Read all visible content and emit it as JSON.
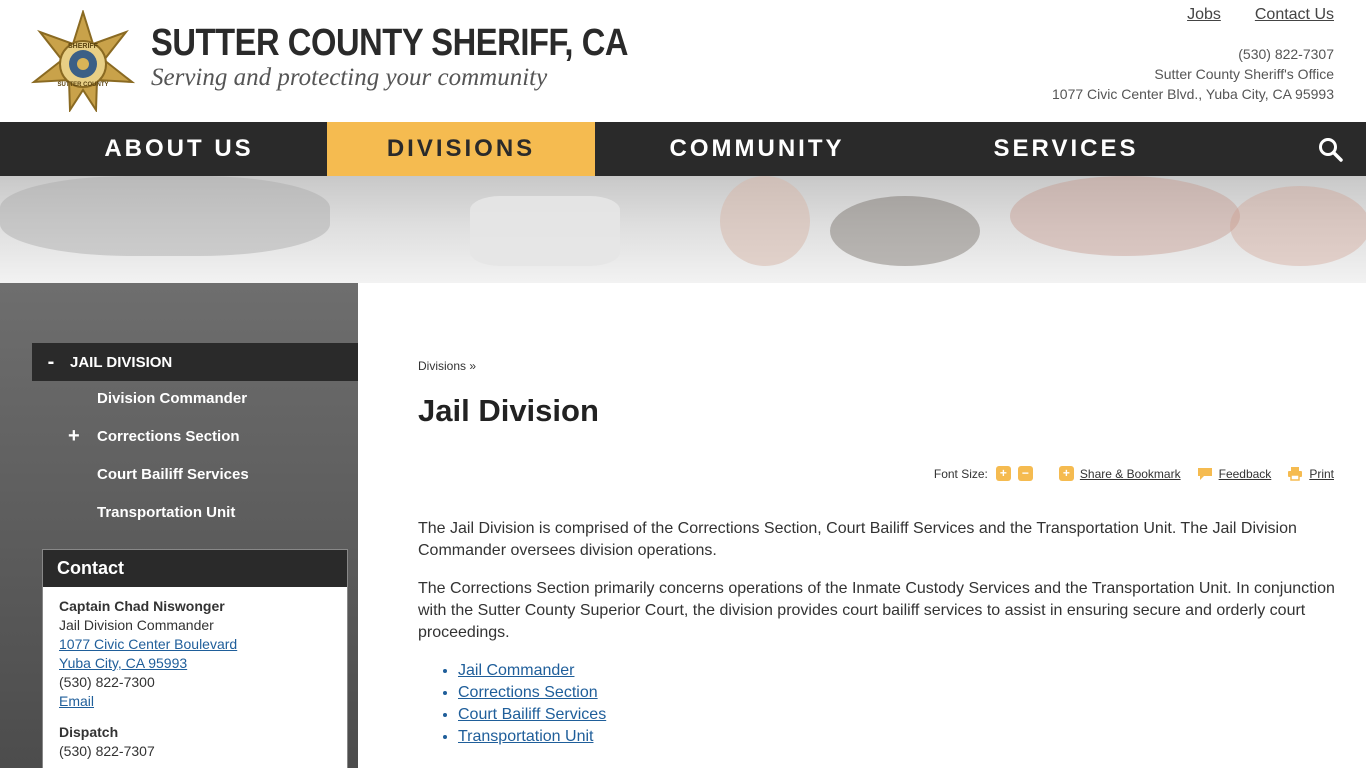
{
  "header": {
    "title": "SUTTER COUNTY SHERIFF, CA",
    "tagline": "Serving and protecting your community",
    "links": [
      {
        "label": "Jobs"
      },
      {
        "label": "Contact Us"
      }
    ],
    "phone": "(530) 822-7307",
    "office": "Sutter County Sheriff's Office",
    "address": "1077 Civic Center Blvd., Yuba City, CA 95993",
    "badge": {
      "top_text": "SHERIFF",
      "bottom_text": "SUTTER COUNTY"
    }
  },
  "nav": {
    "items": [
      {
        "label": "ABOUT US"
      },
      {
        "label": "DIVISIONS",
        "active": true
      },
      {
        "label": "COMMUNITY"
      },
      {
        "label": "SERVICES"
      }
    ],
    "search_icon": "search-icon"
  },
  "sidebar": {
    "active": {
      "toggle": "-",
      "label": "JAIL DIVISION"
    },
    "items": [
      {
        "label": "Division Commander"
      },
      {
        "label": "Corrections Section",
        "toggle": "+"
      },
      {
        "label": "Court Bailiff Services"
      },
      {
        "label": "Transportation Unit"
      }
    ]
  },
  "contact": {
    "heading": "Contact",
    "name": "Captain Chad Niswonger",
    "role": "Jail Division Commander",
    "address_line1": "1077 Civic Center Boulevard",
    "address_line2": "Yuba City, CA 95993",
    "phone": "(530) 822-7300",
    "email_label": "Email",
    "dispatch_heading": "Dispatch",
    "dispatch_phone": "(530) 822-7307"
  },
  "main": {
    "breadcrumb": "Divisions »",
    "title": "Jail Division",
    "tools": {
      "font_size_label": "Font Size:",
      "increase": "+",
      "decrease": "−",
      "share_icon": "+",
      "share_label": "Share & Bookmark",
      "feedback_label": "Feedback",
      "print_label": "Print"
    },
    "paragraphs": [
      "The Jail Division is comprised of the Corrections Section, Court Bailiff Services and the Transportation Unit. The Jail Division Commander oversees division operations.",
      "The Corrections Section primarily concerns operations of the Inmate Custody Services and the Transportation Unit. In conjunction with the Sutter County Superior Court, the division provides court bailiff services to assist in ensuring secure and orderly court proceedings."
    ],
    "links": [
      {
        "label": "Jail Commander"
      },
      {
        "label": "Corrections Section"
      },
      {
        "label": "Court Bailiff Services"
      },
      {
        "label": "Transportation Unit"
      }
    ]
  },
  "colors": {
    "accent": "#f5bb50",
    "nav_bg": "#2a2a2a",
    "link": "#1f5e9a"
  }
}
